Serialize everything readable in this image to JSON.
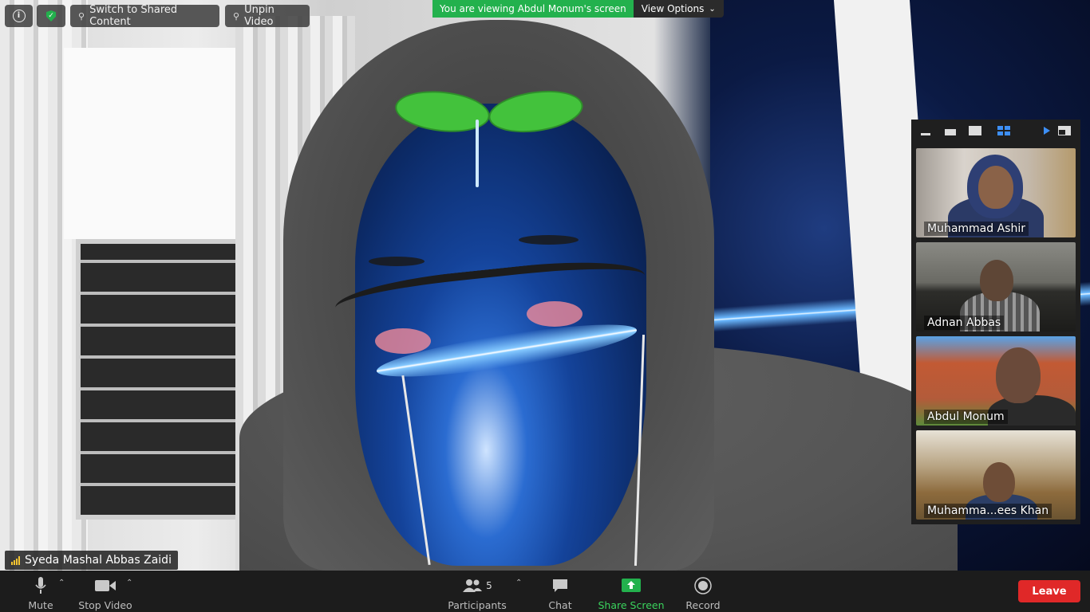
{
  "top_bar": {
    "switch_shared_label": "Switch to Shared Content",
    "unpin_label": "Unpin Video",
    "viewing_text": "You are viewing Abdul Monum's screen",
    "view_options_label": "View Options"
  },
  "main_video": {
    "participant_name": "Syeda Mashal Abbas Zaidi"
  },
  "gallery": {
    "tiles": [
      {
        "name": "Muhammad Ashir"
      },
      {
        "name": "Adnan Abbas"
      },
      {
        "name": "Abdul Monum"
      },
      {
        "name": "Muhamma...ees Khan"
      }
    ]
  },
  "toolbar": {
    "mute_label": "Mute",
    "stop_video_label": "Stop Video",
    "participants_label": "Participants",
    "participants_count": "5",
    "chat_label": "Chat",
    "share_screen_label": "Share Screen",
    "record_label": "Record",
    "leave_label": "Leave"
  },
  "colors": {
    "accent_green": "#23b14d",
    "leave_red": "#e02828",
    "toolbar_bg": "#1c1c1c"
  },
  "icons": [
    "info-icon",
    "shield-icon",
    "pin-icon",
    "chevron-down-icon",
    "signal-icon",
    "microphone-icon",
    "camera-icon",
    "participants-icon",
    "chat-icon",
    "share-screen-icon",
    "record-icon",
    "layout-icons"
  ]
}
